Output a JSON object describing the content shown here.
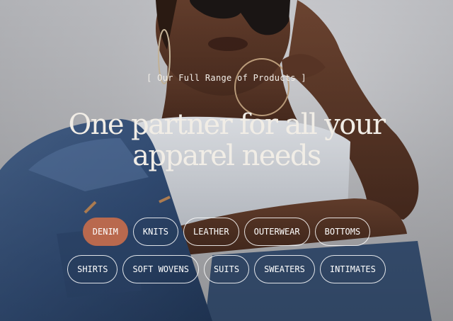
{
  "hero": {
    "eyebrow": "[ Our Full Range of Products ]",
    "headline_line1": "One partner for all your",
    "headline_line2": "apparel needs",
    "photo_description_icon": "hero-photo",
    "accent_color": "#b9694e"
  },
  "categories": {
    "row1": [
      "DENIM",
      "KNITS",
      "LEATHER",
      "OUTERWEAR",
      "BOTTOMS"
    ],
    "row2": [
      "SHIRTS",
      "SOFT WOVENS",
      "SUITS",
      "SWEATERS",
      "INTIMATES"
    ],
    "selected": "DENIM"
  }
}
